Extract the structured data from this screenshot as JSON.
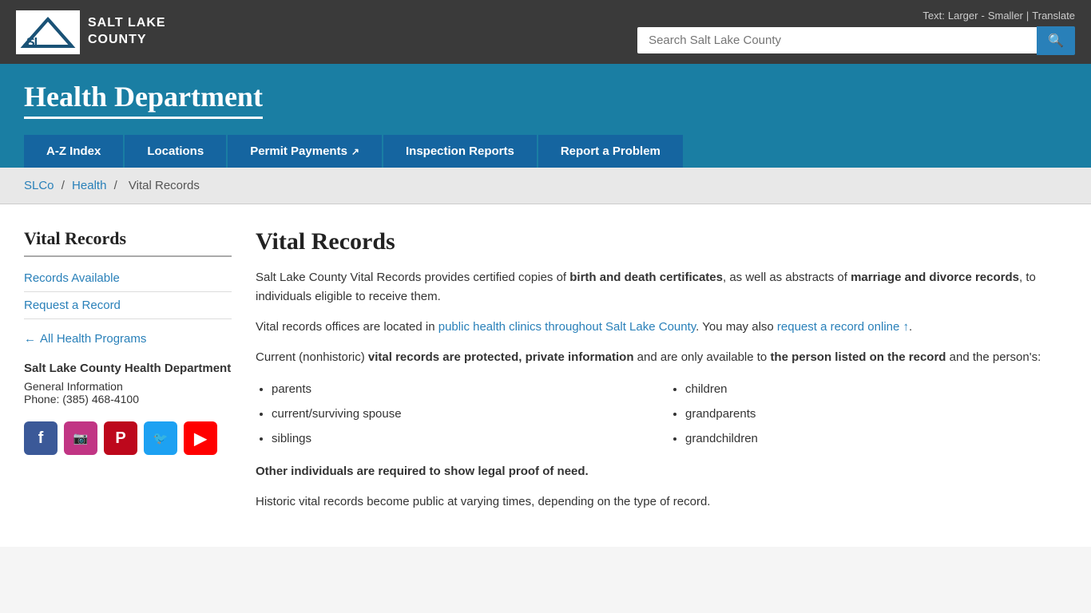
{
  "header": {
    "logo_letters": "SL",
    "logo_title_line1": "SALT LAKE",
    "logo_title_line2": "COUNTY",
    "text_label": "Text:",
    "larger_label": "Larger",
    "smaller_label": "Smaller",
    "translate_label": "Translate",
    "search_placeholder": "Search Salt Lake County"
  },
  "banner": {
    "title": "Health Department"
  },
  "nav": {
    "items": [
      {
        "label": "A-Z Index",
        "external": false
      },
      {
        "label": "Locations",
        "external": false
      },
      {
        "label": "Permit Payments",
        "external": true
      },
      {
        "label": "Inspection Reports",
        "external": false
      },
      {
        "label": "Report a Problem",
        "external": false
      }
    ]
  },
  "breadcrumb": {
    "items": [
      {
        "label": "SLCo",
        "href": "#"
      },
      {
        "label": "Health",
        "href": "#"
      },
      {
        "label": "Vital Records",
        "current": true
      }
    ]
  },
  "sidebar": {
    "title": "Vital Records",
    "nav_items": [
      {
        "label": "Records Available"
      },
      {
        "label": "Request a Record"
      }
    ],
    "back_label": "All Health Programs",
    "org_name": "Salt Lake County Health Department",
    "info_line1": "General Information",
    "info_line2": "Phone: (385) 468-4100",
    "social": [
      {
        "name": "facebook",
        "symbol": "f",
        "class": "fb"
      },
      {
        "name": "instagram",
        "symbol": "📷",
        "class": "ig"
      },
      {
        "name": "pinterest",
        "symbol": "P",
        "class": "pi"
      },
      {
        "name": "twitter",
        "symbol": "🐦",
        "class": "tw"
      },
      {
        "name": "youtube",
        "symbol": "▶",
        "class": "yt"
      }
    ]
  },
  "content": {
    "title": "Vital Records",
    "para1_prefix": "Salt Lake County Vital Records provides certified copies of ",
    "para1_bold1": "birth and death certificates",
    "para1_mid": ", as well as abstracts of ",
    "para1_bold2": "marriage and divorce records",
    "para1_suffix": ", to individuals eligible to receive them.",
    "para2_prefix": "Vital records offices are located in ",
    "para2_link1": "public health clinics throughout Salt Lake County",
    "para2_mid": ". You may also ",
    "para2_link2": "request a record online ↑",
    "para2_suffix": ".",
    "para3_prefix": "Current (nonhistoric) ",
    "para3_bold1": "vital records are protected, private information",
    "para3_mid": " and are only available to ",
    "para3_bold2": "the person listed on the record",
    "para3_suffix": " and the person's:",
    "list_col1": [
      "parents",
      "current/surviving spouse",
      "siblings"
    ],
    "list_col2": [
      "children",
      "grandparents",
      "grandchildren"
    ],
    "warning": "Other individuals are required to show legal proof of need.",
    "para4": "Historic vital records become public at varying times, depending on the type of record."
  }
}
